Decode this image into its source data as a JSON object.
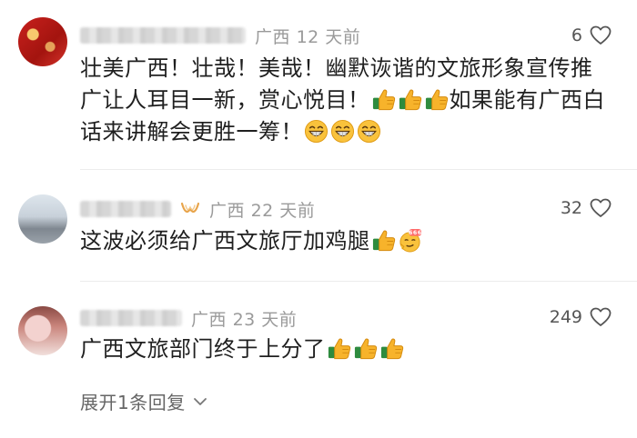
{
  "comments": [
    {
      "region": "广西",
      "time": "12 天前",
      "likes": "6",
      "text_a": "壮美广西！壮哉！美哉！幽默诙谐的文旅形象宣传推广让人耳目一新，赏心悦目！",
      "text_b": "如果能有广西白话来讲解会更胜一筹！"
    },
    {
      "region": "广西",
      "time": "22 天前",
      "likes": "32",
      "text_a": "这波必须给广西文旅厅加鸡腿"
    },
    {
      "region": "广西",
      "time": "23 天前",
      "likes": "249",
      "text_a": "广西文旅部门终于上分了"
    }
  ],
  "expand_label": "展开1条回复",
  "icons": {
    "like": "heart-outline-icon",
    "thumbs": "thumbs-up-emoji",
    "grin": "grinning-emoji",
    "sixsix": "666-emoji",
    "expand": "chevron-down-icon",
    "vip": "vip-badge-icon"
  },
  "colors": {
    "meta": "#9a9a9a",
    "text": "#1f1f1f",
    "likes": "#555555",
    "divider": "#ececec"
  }
}
